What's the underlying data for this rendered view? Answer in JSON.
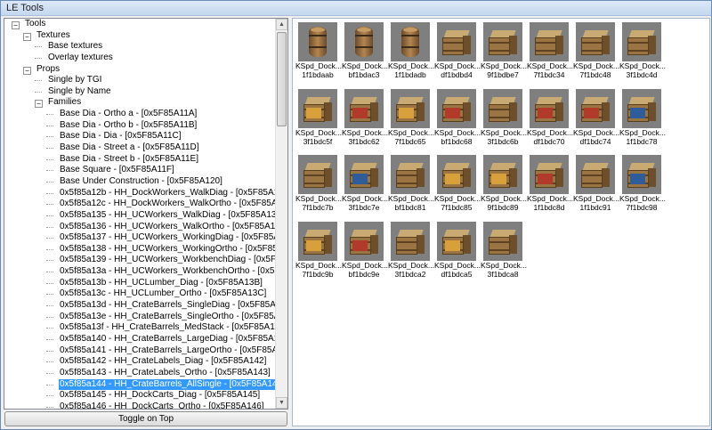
{
  "window": {
    "title": "LE Tools"
  },
  "tree": {
    "rows": [
      {
        "text": "Tools",
        "expander": "−"
      },
      {
        "text": "Textures",
        "expander": "−"
      },
      {
        "text": "Base textures"
      },
      {
        "text": "Overlay textures"
      },
      {
        "text": "Props",
        "expander": "−"
      },
      {
        "text": "Single by TGI"
      },
      {
        "text": "Single by Name"
      },
      {
        "text": "Families",
        "expander": "−"
      },
      {
        "text": "Base Dia - Ortho a - [0x5F85A11A]"
      },
      {
        "text": "Base Dia - Ortho b - [0x5F85A11B]"
      },
      {
        "text": "Base Dia - Dia - [0x5F85A11C]"
      },
      {
        "text": "Base Dia - Street a - [0x5F85A11D]"
      },
      {
        "text": "Base Dia - Street b - [0x5F85A11E]"
      },
      {
        "text": "Base Square - [0x5F85A11F]"
      },
      {
        "text": "Base Under Construction - [0x5F85A120]"
      },
      {
        "text": "0x5f85a12b - HH_DockWorkers_WalkDiag - [0x5F85A12B]"
      },
      {
        "text": "0x5f85a12c - HH_DockWorkers_WalkOrtho - [0x5F85A12C]"
      },
      {
        "text": "0x5f85a135 - HH_UCWorkers_WalkDiag - [0x5F85A135]"
      },
      {
        "text": "0x5f85a136 - HH_UCWorkers_WalkOrtho - [0x5F85A136]"
      },
      {
        "text": "0x5f85a137 - HH_UCWorkers_WorkingDiag - [0x5F85A137]"
      },
      {
        "text": "0x5f85a138 - HH_UCWorkers_WorkingOrtho - [0x5F85A138]"
      },
      {
        "text": "0x5f85a139 - HH_UCWorkers_WorkbenchDiag - [0x5F85A139]"
      },
      {
        "text": "0x5f85a13a - HH_UCWorkers_WorkbenchOrtho - [0x5F85A13A]"
      },
      {
        "text": "0x5f85a13b - HH_UCLumber_Diag - [0x5F85A13B]"
      },
      {
        "text": "0x5f85a13c - HH_UCLumber_Ortho - [0x5F85A13C]"
      },
      {
        "text": "0x5f85a13d - HH_CrateBarrels_SingleDiag - [0x5F85A13D]"
      },
      {
        "text": "0x5f85a13e - HH_CrateBarrels_SingleOrtho - [0x5F85A13E]"
      },
      {
        "text": "0x5f85a13f - HH_CrateBarrels_MedStack - [0x5F85A13F]"
      },
      {
        "text": "0x5f85a140 - HH_CrateBarrels_LargeDiag - [0x5F85A140]"
      },
      {
        "text": "0x5f85a141 - HH_CrateBarrels_LargeOrtho - [0x5F85A141]"
      },
      {
        "text": "0x5f85a142 - HH_CrateLabels_Diag - [0x5F85A142]"
      },
      {
        "text": "0x5f85a143 - HH_CrateLabels_Ortho - [0x5F85A143]"
      },
      {
        "text": "0x5f85a144 - HH_CrateBarrels_AllSingle - [0x5F85A144]",
        "selected": true
      },
      {
        "text": "0x5f85a145 - HH_DockCarts_Diag - [0x5F85A145]"
      },
      {
        "text": "0x5f85a146 - HH_DockCarts_Ortho - [0x5F85A146]"
      }
    ]
  },
  "toggle_button": "Toggle on Top",
  "thumbnails": [
    {
      "name": "KSpd_Dock...",
      "id": "1f1bdaab",
      "kind": "barrel"
    },
    {
      "name": "KSpd_Dock...",
      "id": "bf1bdac3",
      "kind": "barrel"
    },
    {
      "name": "KSpd_Dock...",
      "id": "1f1bdadb",
      "kind": "barrel"
    },
    {
      "name": "KSpd_Dock...",
      "id": "df1bdbd4",
      "kind": "crate"
    },
    {
      "name": "KSpd_Dock...",
      "id": "9f1bdbe7",
      "kind": "crate"
    },
    {
      "name": "KSpd_Dock...",
      "id": "7f1bdc34",
      "kind": "crate"
    },
    {
      "name": "KSpd_Dock...",
      "id": "7f1bdc48",
      "kind": "crate"
    },
    {
      "name": "KSpd_Dock...",
      "id": "3f1bdc4d",
      "kind": "crate"
    },
    {
      "name": "KSpd_Dock...",
      "id": "3f1bdc5f",
      "kind": "crate-c"
    },
    {
      "name": "KSpd_Dock...",
      "id": "3f1bdc62",
      "kind": "crate-a"
    },
    {
      "name": "KSpd_Dock...",
      "id": "7f1bdc65",
      "kind": "crate-c"
    },
    {
      "name": "KSpd_Dock...",
      "id": "bf1bdc68",
      "kind": "crate-a"
    },
    {
      "name": "KSpd_Dock...",
      "id": "3f1bdc6b",
      "kind": "crate"
    },
    {
      "name": "KSpd_Dock...",
      "id": "df1bdc70",
      "kind": "crate-a"
    },
    {
      "name": "KSpd_Dock...",
      "id": "df1bdc74",
      "kind": "crate-a"
    },
    {
      "name": "KSpd_Dock...",
      "id": "1f1bdc78",
      "kind": "crate-b"
    },
    {
      "name": "KSpd_Dock...",
      "id": "7f1bdc7b",
      "kind": "crate"
    },
    {
      "name": "KSpd_Dock...",
      "id": "3f1bdc7e",
      "kind": "crate-b"
    },
    {
      "name": "KSpd_Dock...",
      "id": "bf1bdc81",
      "kind": "crate"
    },
    {
      "name": "KSpd_Dock...",
      "id": "7f1bdc85",
      "kind": "crate-c"
    },
    {
      "name": "KSpd_Dock...",
      "id": "9f1bdc89",
      "kind": "crate-c"
    },
    {
      "name": "KSpd_Dock...",
      "id": "1f1bdc8d",
      "kind": "crate-a"
    },
    {
      "name": "KSpd_Dock...",
      "id": "1f1bdc91",
      "kind": "crate"
    },
    {
      "name": "KSpd_Dock...",
      "id": "7f1bdc98",
      "kind": "crate-b"
    },
    {
      "name": "KSpd_Dock...",
      "id": "7f1bdc9b",
      "kind": "crate-c"
    },
    {
      "name": "KSpd_Dock...",
      "id": "bf1bdc9e",
      "kind": "crate-a"
    },
    {
      "name": "KSpd_Dock...",
      "id": "3f1bdca2",
      "kind": "crate"
    },
    {
      "name": "KSpd_Dock...",
      "id": "df1bdca5",
      "kind": "crate-c"
    },
    {
      "name": "KSpd_Dock...",
      "id": "3f1bdca8",
      "kind": "crate"
    }
  ]
}
